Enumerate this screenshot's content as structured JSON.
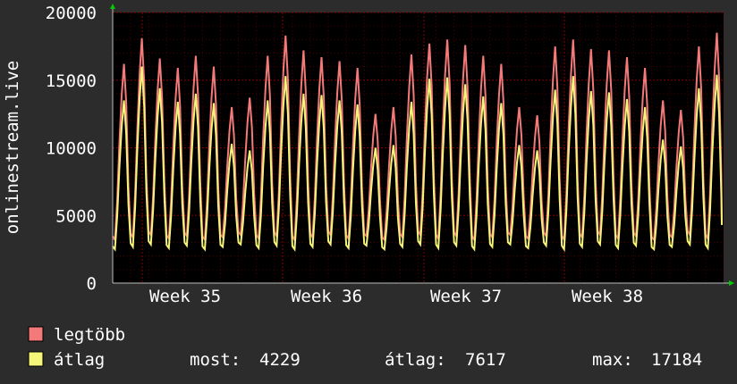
{
  "chart_data": {
    "type": "line",
    "ylabel": "onlinestream.live",
    "ylim": [
      0,
      20000
    ],
    "y_ticks": [
      "0",
      "5000",
      "10000",
      "15000",
      "20000"
    ],
    "x_ticks": [
      "Week 35",
      "Week 36",
      "Week 37",
      "Week 38"
    ],
    "grid": true,
    "legend_placement": "bottom-left",
    "colors": {
      "background": "#2c2c2c",
      "plot_background": "#000000",
      "grid": "#8b0000",
      "axis": "#bdbdbd",
      "arrow": "#00cc00",
      "text": "#ffffff"
    },
    "days": 34,
    "series": [
      {
        "name": "legtöbb",
        "color": "#f47a7a",
        "daily_peaks": [
          16200,
          18100,
          16600,
          15900,
          16800,
          16000,
          13000,
          13700,
          16800,
          18300,
          17200,
          16700,
          16400,
          15900,
          12500,
          13000,
          16900,
          17700,
          18000,
          17600,
          16800,
          16200,
          13000,
          12400,
          17500,
          18000,
          17300,
          17200,
          16700,
          15900,
          13500,
          12800,
          17500,
          18500
        ]
      },
      {
        "name": "átlag",
        "color": "#f5f57a",
        "daily_peaks": [
          13500,
          16000,
          14400,
          13400,
          14000,
          13300,
          10300,
          9800,
          13500,
          15300,
          14000,
          13900,
          13500,
          13200,
          10000,
          10200,
          13400,
          15100,
          15200,
          14700,
          13800,
          13300,
          10200,
          9800,
          14300,
          15300,
          14200,
          14100,
          13600,
          13000,
          10600,
          10100,
          14400,
          15400
        ]
      }
    ],
    "stats": {
      "now_label": "most:",
      "now_value": "4229",
      "avg_label": "átlag:",
      "avg_value": "7617",
      "max_label": "max:",
      "max_value": "17184"
    }
  }
}
